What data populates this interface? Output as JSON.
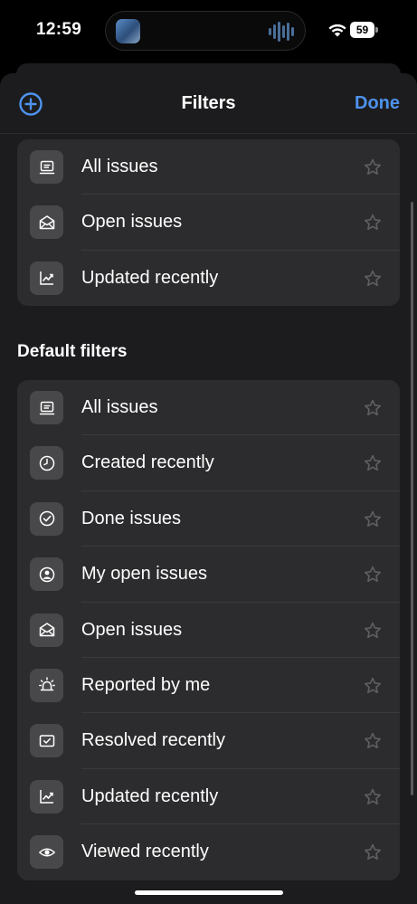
{
  "status_bar": {
    "time": "12:59",
    "battery": "59"
  },
  "sheet": {
    "add_icon": "plus-circle-icon",
    "title": "Filters",
    "done_label": "Done"
  },
  "saved_filters": [
    {
      "label": "All issues",
      "icon": "inbox-icon"
    },
    {
      "label": "Open issues",
      "icon": "open-envelope-icon"
    },
    {
      "label": "Updated recently",
      "icon": "trend-chart-icon"
    }
  ],
  "default_filters_header": "Default filters",
  "default_filters": [
    {
      "label": "All issues",
      "icon": "inbox-icon"
    },
    {
      "label": "Created recently",
      "icon": "clock-icon"
    },
    {
      "label": "Done issues",
      "icon": "check-circle-icon"
    },
    {
      "label": "My open issues",
      "icon": "person-circle-icon"
    },
    {
      "label": "Open issues",
      "icon": "open-envelope-icon"
    },
    {
      "label": "Reported by me",
      "icon": "alarm-light-icon"
    },
    {
      "label": "Resolved recently",
      "icon": "checkbox-screen-icon"
    },
    {
      "label": "Updated recently",
      "icon": "trend-chart-icon"
    },
    {
      "label": "Viewed recently",
      "icon": "eye-icon"
    }
  ],
  "colors": {
    "accent": "#4e92ed",
    "sheet_background": "#1c1c1e",
    "group_background": "#2c2c2e",
    "icon_tile": "#48484a"
  }
}
